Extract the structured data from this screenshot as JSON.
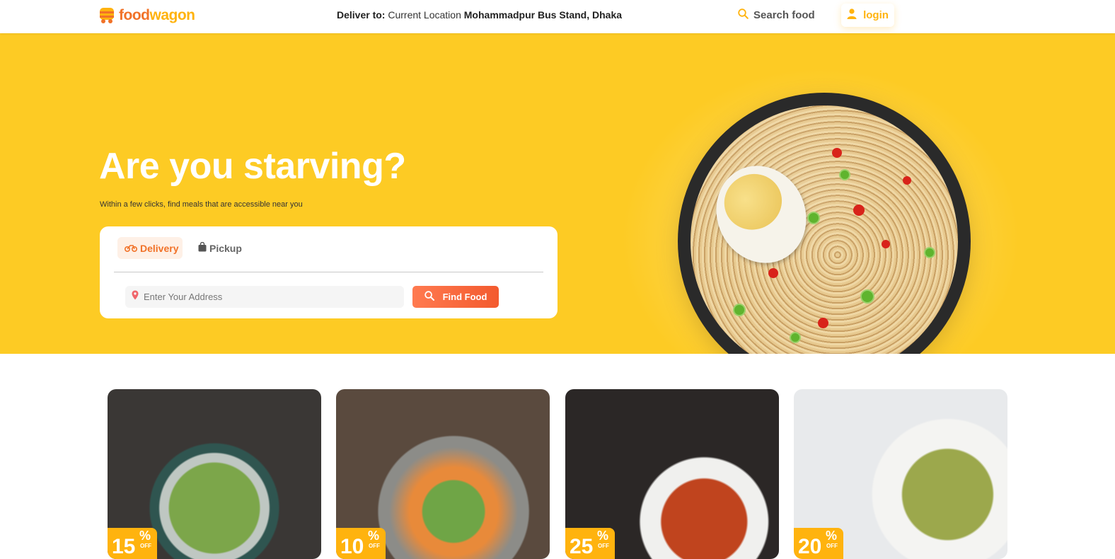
{
  "brand": {
    "name_part1": "food",
    "name_part2": "wagon",
    "primary_color": "#F17228",
    "accent_color": "#FFB30E",
    "hero_color": "#FDCB24"
  },
  "nav": {
    "deliver_label": "Deliver to:",
    "current_location_label": "Current Location",
    "address": "Mohammadpur Bus Stand, Dhaka",
    "search_label": "Search food",
    "login_label": "login"
  },
  "hero": {
    "title": "Are you starving?",
    "subtitle": "Within a few clicks, find meals that are accessible near you",
    "tabs": [
      {
        "label": "Delivery",
        "icon": "motorcycle-icon",
        "active": true
      },
      {
        "label": "Pickup",
        "icon": "shopping-bag-icon",
        "active": false
      }
    ],
    "address_placeholder": "Enter Your Address",
    "find_button_label": "Find Food"
  },
  "deals": [
    {
      "discount": "15",
      "percent": "%",
      "off": "OFF"
    },
    {
      "discount": "10",
      "percent": "%",
      "off": "OFF"
    },
    {
      "discount": "25",
      "percent": "%",
      "off": "OFF"
    },
    {
      "discount": "20",
      "percent": "%",
      "off": "OFF"
    }
  ]
}
